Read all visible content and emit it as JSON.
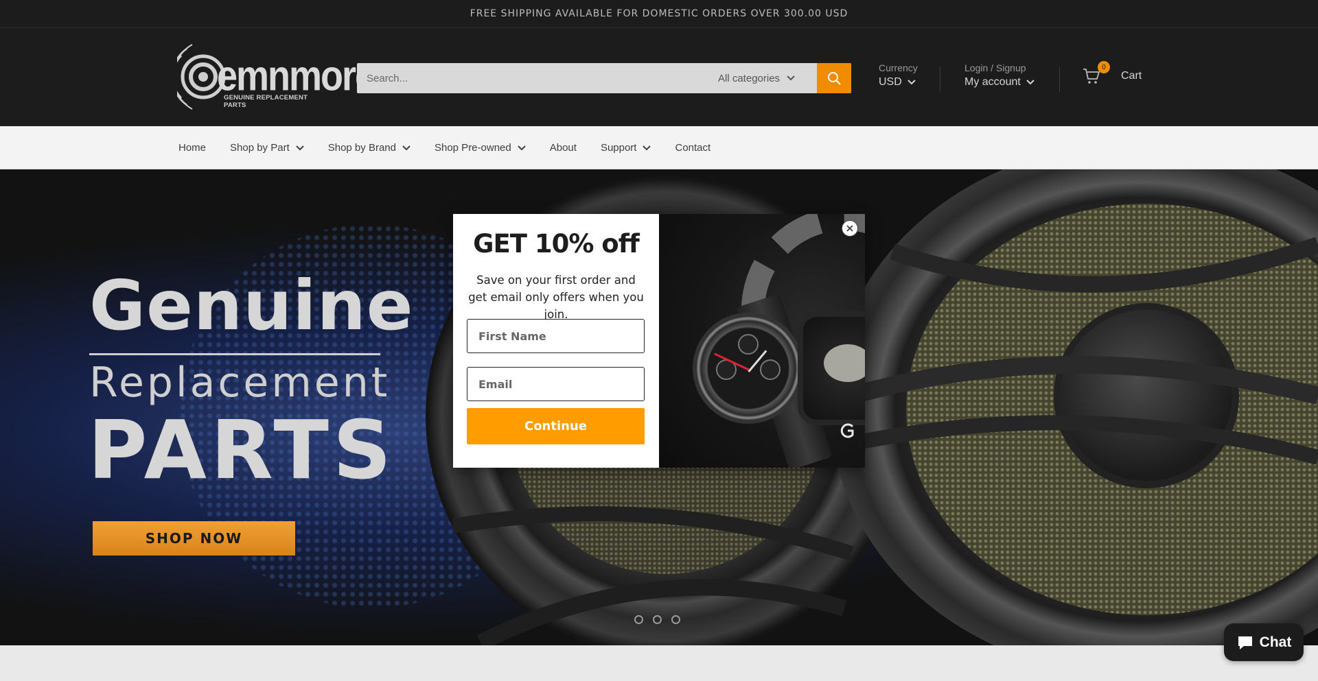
{
  "announcement": "FREE SHIPPING AVAILABLE FOR DOMESTIC ORDERS OVER 300.00 USD",
  "logo": {
    "word": "emnmore",
    "tagline": "GENUINE REPLACEMENT PARTS"
  },
  "search": {
    "placeholder": "Search...",
    "category": "All categories",
    "icon": "search-icon"
  },
  "currency": {
    "label": "Currency",
    "value": "USD"
  },
  "account": {
    "label": "Login / Signup",
    "value": "My account"
  },
  "cart": {
    "count": "0",
    "label": "Cart",
    "icon": "cart-icon"
  },
  "nav": {
    "items": [
      {
        "label": "Home",
        "dropdown": false
      },
      {
        "label": "Shop by Part",
        "dropdown": true
      },
      {
        "label": "Shop by Brand",
        "dropdown": true
      },
      {
        "label": "Shop Pre-owned",
        "dropdown": true
      },
      {
        "label": "About",
        "dropdown": false
      },
      {
        "label": "Support",
        "dropdown": true
      },
      {
        "label": "Contact",
        "dropdown": false
      }
    ]
  },
  "hero": {
    "line1": "Genuine",
    "line2": "Replacement",
    "line3": "PARTS",
    "cta": "SHOP NOW",
    "slides": 3,
    "active_slide": 2
  },
  "popup": {
    "title": "GET 10% off",
    "subtitle": "Save on your first order and get email only offers when you join.",
    "first_name_placeholder": "First Name",
    "email_placeholder": "Email",
    "button": "Continue"
  },
  "chat": {
    "label": "Chat",
    "icon": "chat-bubble-icon"
  },
  "colors": {
    "accent": "#f08c00",
    "popup_button": "#ff9c00",
    "header_bg": "#1c1c1c",
    "nav_bg": "#f3f3f3"
  }
}
